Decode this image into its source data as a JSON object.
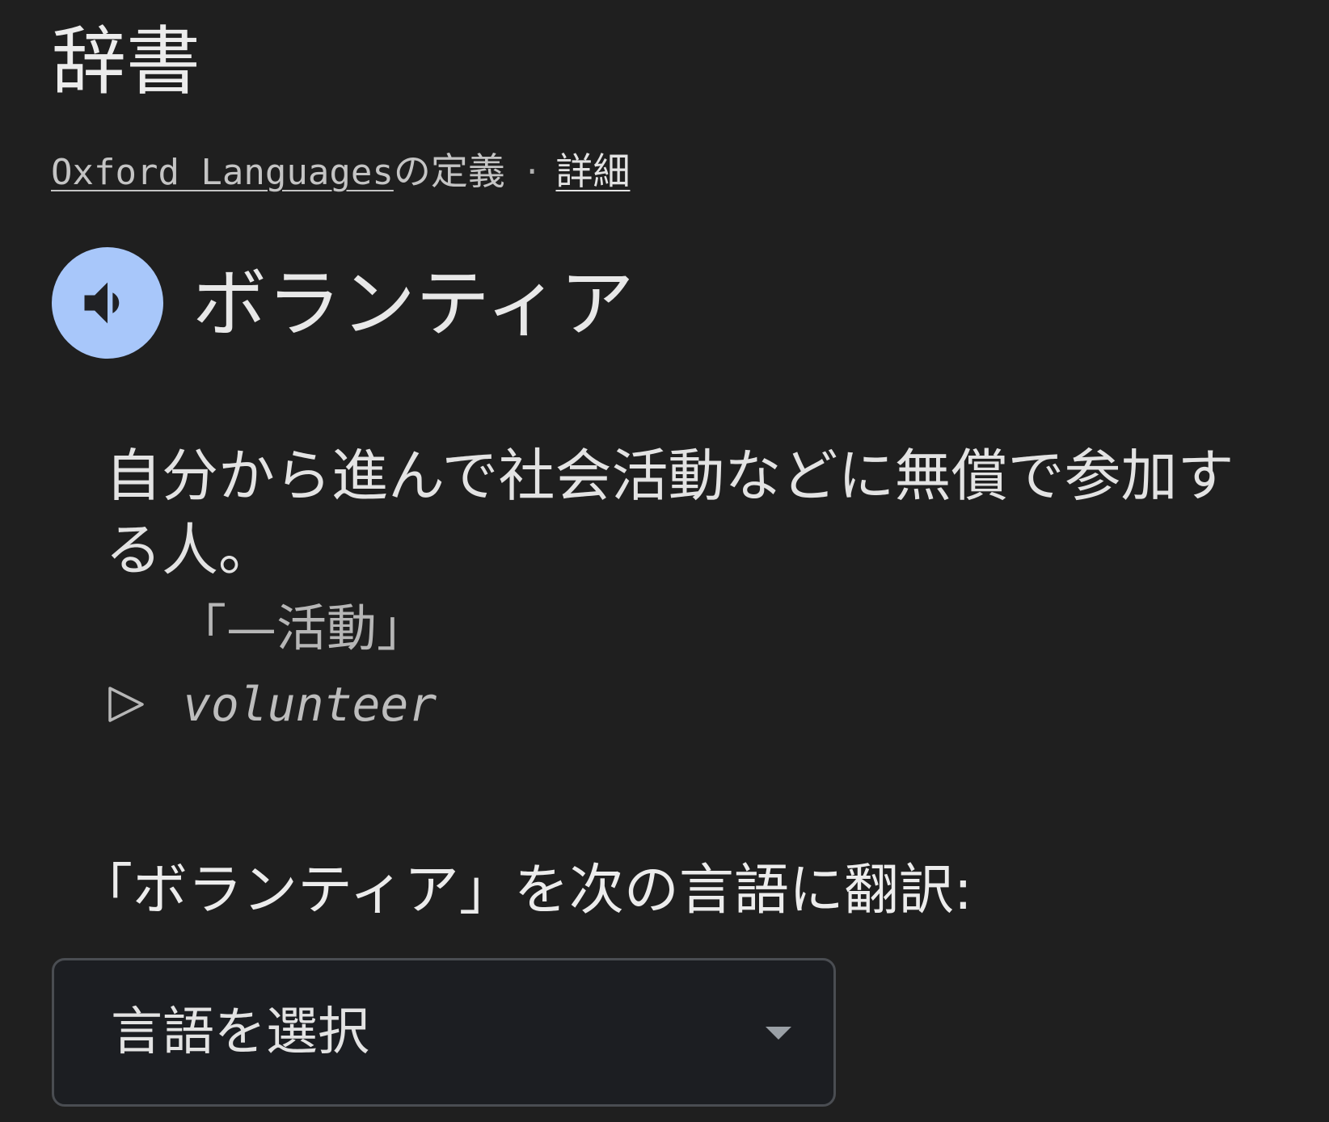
{
  "header": {
    "title": "辞書"
  },
  "source": {
    "provider_link": "Oxford Languages",
    "suffix": "の定義",
    "separator": "·",
    "more_link": "詳細"
  },
  "entry": {
    "headword": "ボランティア",
    "definition": "自分から進んで社会活動などに無償で参加する人。",
    "example": "「—活動」",
    "translation": "volunteer"
  },
  "translate": {
    "label": "「ボランティア」を次の言語に翻訳:",
    "select_value": "言語を選択"
  },
  "colors": {
    "background": "#1f1f1f",
    "speaker_button": "#a8c7fa",
    "select_border": "#4a4d52"
  },
  "icons": {
    "speaker": "volume-up-icon",
    "expand": "play-triangle-outline-icon",
    "dropdown": "caret-down-icon"
  }
}
